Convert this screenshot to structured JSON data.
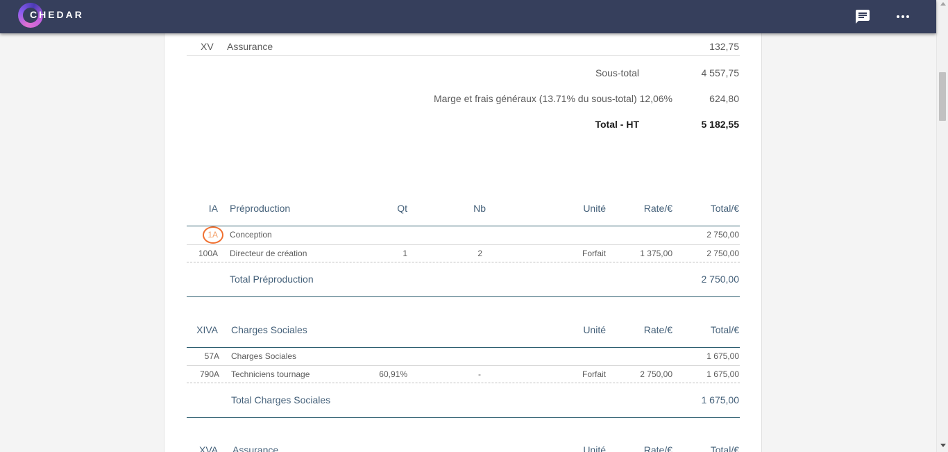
{
  "app": {
    "logo_text": "CHEDAR"
  },
  "topbar": {
    "chat_icon": "chat-icon",
    "more_icon": "more-horizontal-icon"
  },
  "prev_section": {
    "row": {
      "code": "XV",
      "label": "Assurance",
      "total": "132,75"
    },
    "subtotal": {
      "label": "Sous-total",
      "value": "4 557,75"
    },
    "marge": {
      "label": "Marge et frais généraux (13.71% du sous-total) 12,06%",
      "value": "624,80"
    },
    "total_ht": {
      "label": "Total - HT",
      "value": "5 182,55"
    }
  },
  "sections": [
    {
      "code": "IA",
      "title": "Préproduction",
      "headers": {
        "qt": "Qt",
        "nb": "Nb",
        "unite": "Unité",
        "rate": "Rate/€",
        "total": "Total/€"
      },
      "group": {
        "code": "1A",
        "label": "Conception",
        "total": "2 750,00"
      },
      "line": {
        "code": "100A",
        "label": "Directeur de création",
        "qt": "1",
        "nb": "2",
        "unite": "Forfait",
        "rate": "1 375,00",
        "total": "2 750,00"
      },
      "footer": {
        "label": "Total Préproduction",
        "value": "2 750,00"
      }
    },
    {
      "code": "XIVA",
      "title": "Charges Sociales",
      "headers": {
        "unite": "Unité",
        "rate": "Rate/€",
        "total": "Total/€"
      },
      "group": {
        "code": "57A",
        "label": "Charges Sociales",
        "total": "1 675,00"
      },
      "line": {
        "code": "790A",
        "label": "Techniciens tournage",
        "qt": "60,91%",
        "nb": "-",
        "unite": "Forfait",
        "rate": "2 750,00",
        "total": "1 675,00"
      },
      "footer": {
        "label": "Total Charges Sociales",
        "value": "1 675,00"
      }
    },
    {
      "code": "XVA",
      "title": "Assurance",
      "headers": {
        "unite": "Unité",
        "rate": "Rate/€",
        "total": "Total/€"
      }
    }
  ]
}
